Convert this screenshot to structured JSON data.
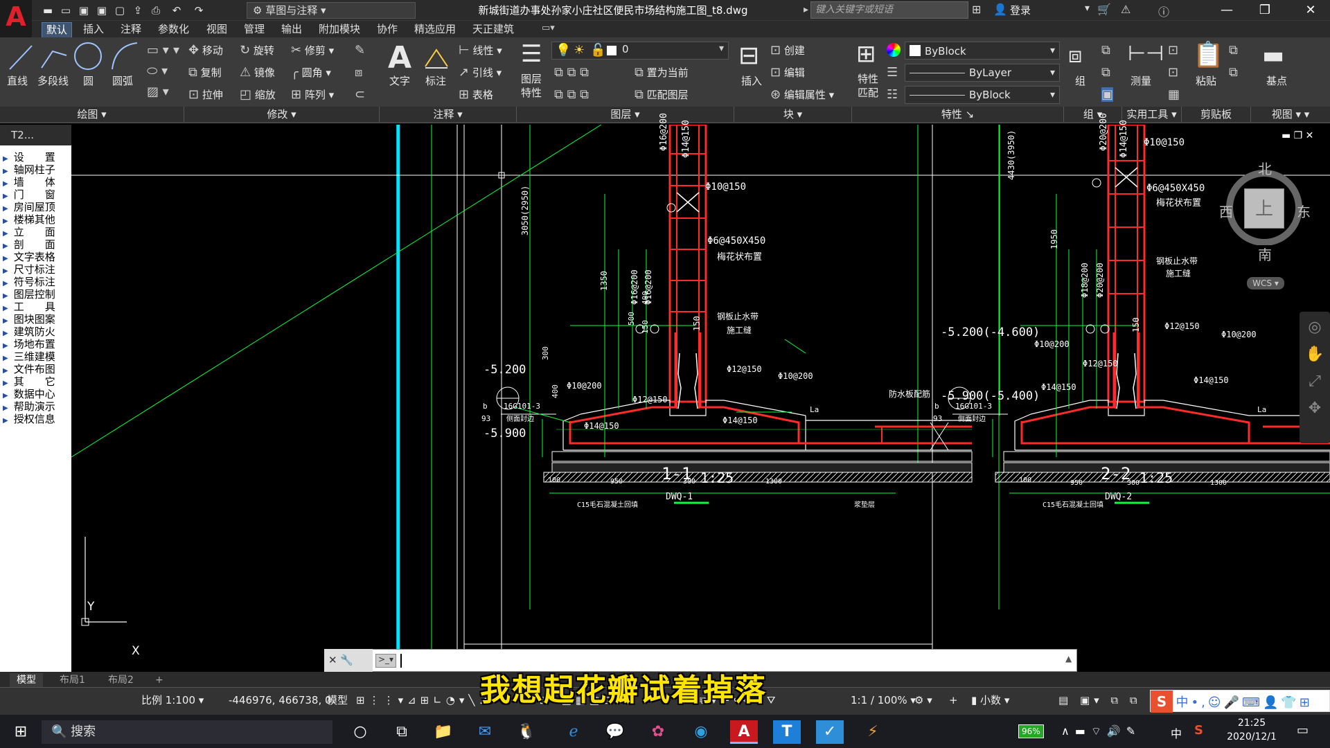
{
  "title_bar": {
    "workspace": "草图与注释",
    "document_title": "新城街道办事处孙家小庄社区便民市场结构施工图_t8.dwg",
    "search_placeholder": "键入关键字或短语",
    "login": "登录"
  },
  "ribbon_tabs": [
    "默认",
    "插入",
    "注释",
    "参数化",
    "视图",
    "管理",
    "输出",
    "附加模块",
    "协作",
    "精选应用",
    "天正建筑"
  ],
  "draw_panel": {
    "buttons": [
      "直线",
      "多段线",
      "圆",
      "圆弧"
    ],
    "label": "绘图"
  },
  "modify_panel": {
    "rows": [
      [
        "移动",
        "旋转",
        "修剪"
      ],
      [
        "复制",
        "镜像",
        "圆角"
      ],
      [
        "拉伸",
        "缩放",
        "阵列"
      ]
    ],
    "label": "修改"
  },
  "annotation_panel": {
    "big": [
      "文字",
      "标注"
    ],
    "small": [
      "线性",
      "引线",
      "表格"
    ],
    "label": "注释"
  },
  "layers_panel": {
    "big": "图层\n特性",
    "current_layer": "0",
    "actions": [
      "置为当前",
      "匹配图层"
    ],
    "label": "图层"
  },
  "block_panel": {
    "big": "插入",
    "actions": [
      "创建",
      "编辑",
      "编辑属性"
    ],
    "label": "块"
  },
  "properties_panel": {
    "big": "特性\n匹配",
    "color": "ByBlock",
    "linetype": "ByLayer",
    "lineweight": "ByBlock",
    "label": "特性"
  },
  "group_panel": {
    "big": "组",
    "label": "组"
  },
  "utilities_panel": {
    "big": "测量",
    "label": "实用工具"
  },
  "clipboard_panel": {
    "big": "粘贴",
    "label": "剪贴板"
  },
  "view_panel": {
    "big": "基点",
    "label": "视图"
  },
  "sidebar": {
    "header": "T2...",
    "items": [
      "设　　置",
      "轴网柱子",
      "墙　　体",
      "门　　窗",
      "房间屋顶",
      "楼梯其他",
      "立　　面",
      "剖　　面",
      "文字表格",
      "尺寸标注",
      "符号标注",
      "图层控制",
      "工　　具",
      "图块图案",
      "建筑防火",
      "场地布置",
      "三维建模",
      "文件布图",
      "其　　它",
      "数据中心",
      "帮助演示",
      "授权信息"
    ]
  },
  "viewcube": {
    "north": "北",
    "south": "南",
    "east": "东",
    "west": "西",
    "top": "上",
    "wcs": "WCS"
  },
  "drawing": {
    "left": {
      "rebar_top": [
        "Φ16@200",
        "Φ14@150"
      ],
      "rebar": [
        "Φ10@150",
        "Φ6@450X450",
        "梅花状布置",
        "钢板止水带",
        "施工缝",
        "Φ12@150",
        "Φ10@200",
        "Φ12@150",
        "Φ10@200",
        "Φ14@150",
        "Φ14@150",
        "防水板配筋"
      ],
      "elev_top": "-5.200",
      "elev_bot": "-5.900",
      "dims_v": [
        "3050(2950)",
        "1350",
        "500",
        "300",
        "400",
        "150",
        "150",
        "200",
        "400",
        "300"
      ],
      "dims_h": [
        "100",
        "950",
        "300",
        "1300"
      ],
      "vert_rebar": [
        "Φ16@200",
        "Φ16@200"
      ],
      "note": "C15毛石混凝土回填",
      "note2": "浆垫层",
      "callout_ref": "16G101-3",
      "callout_sub": "侧面封边",
      "callout_b": "b",
      "callout_num": "93",
      "section": "1-1",
      "scale": "1:25",
      "sub": "DWQ-1",
      "la": "La"
    },
    "right": {
      "rebar_top": [
        "Φ20@200",
        "Φ14@150"
      ],
      "rebar": [
        "Φ10@150",
        "Φ6@450X450",
        "梅花状布置",
        "钢板止水带",
        "施工缝",
        "Φ12@150",
        "Φ10@200",
        "Φ12@150",
        "Φ10@200",
        "Φ14@150",
        "Φ14@150"
      ],
      "elev_top": "-5.200(-4.600)",
      "elev_bot": "-5.900(-5.400)",
      "dims_v": [
        "4430(3950)",
        "1950",
        "500",
        "300",
        "400",
        "150",
        "150",
        "200"
      ],
      "dims_h": [
        "100",
        "950",
        "300",
        "1300"
      ],
      "vert_rebar": [
        "Φ18@200",
        "Φ20@200"
      ],
      "note": "C15毛石混凝土回填",
      "callout_ref": "16G101-3",
      "callout_sub": "侧面封边",
      "callout_b": "b",
      "callout_num": "93",
      "section": "2-2",
      "scale": "1:25",
      "sub": "DWQ-2",
      "la": "La"
    }
  },
  "ucs": {
    "x": "X",
    "y": "Y"
  },
  "layout_tabs": [
    "模型",
    "布局1",
    "布局2"
  ],
  "status_bar": {
    "scale": "比例 1:100",
    "coords": "-446976, 466738, 0",
    "model": "模型",
    "anno_scale": "1:1 / 100%",
    "units": "小数"
  },
  "subtitle": "我想起花瓣试着掉落",
  "taskbar": {
    "search": "搜索",
    "battery": "96%",
    "ime": "中",
    "time": "21:25",
    "date": "2020/12/1"
  },
  "colors": {
    "accent": "#3f5470",
    "rebar": "#ff2a2a",
    "dim": "#00ff3c",
    "cyan": "#00e5ff",
    "subtitle": "#ffe500"
  }
}
